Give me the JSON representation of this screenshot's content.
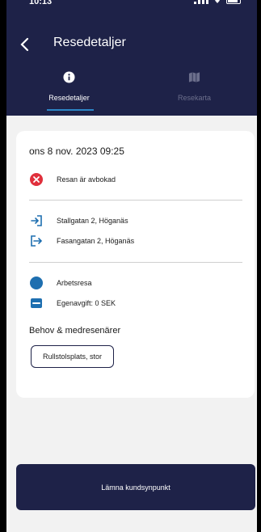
{
  "status_bar": {
    "time": "10:13"
  },
  "header": {
    "title": "Resedetaljer"
  },
  "tabs": [
    {
      "label": "Resedetaljer",
      "icon": "info-icon",
      "active": true
    },
    {
      "label": "Resekarta",
      "icon": "map-icon",
      "active": false
    }
  ],
  "trip": {
    "datetime": "ons 8 nov. 2023 09:25",
    "status": "Resan är avbokad",
    "from": "Stallgatan 2, Höganäs",
    "to": "Fasangatan 2, Höganäs",
    "trip_type": "Arbetsresa",
    "fee": "Egenavgift: 0 SEK",
    "needs_title": "Behov & medresenärer",
    "needs": [
      "Rullstolsplats, stor"
    ]
  },
  "actions": {
    "feedback_label": "Lämna kundsynpunkt"
  },
  "colors": {
    "header_bg": "#1e2248",
    "accent": "#2c86c6",
    "cancel_red": "#e0303c",
    "background": "#f2f2f2"
  }
}
